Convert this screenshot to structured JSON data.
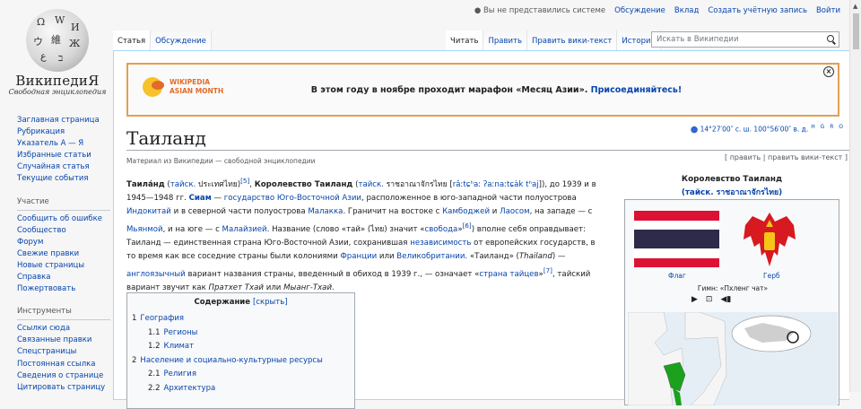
{
  "logo": {
    "title": "ВикипедиЯ",
    "subtitle": "Свободная энциклопедия"
  },
  "personal": {
    "anon": "Вы не представились системе",
    "links": [
      "Обсуждение",
      "Вклад",
      "Создать учётную запись",
      "Войти"
    ]
  },
  "tabs": {
    "left": [
      "Статья",
      "Обсуждение"
    ],
    "right": [
      "Читать",
      "Править",
      "Править вики-текст",
      "История"
    ]
  },
  "search": {
    "placeholder": "Искать в Википедии"
  },
  "sidebar": {
    "nav": [
      "Заглавная страница",
      "Рубрикация",
      "Указатель А — Я",
      "Избранные статьи",
      "Случайная статья",
      "Текущие события"
    ],
    "participation_head": "Участие",
    "participation": [
      "Сообщить об ошибке",
      "Сообщество",
      "Форум",
      "Свежие правки",
      "Новые страницы",
      "Справка",
      "Пожертвовать"
    ],
    "tools_head": "Инструменты",
    "tools": [
      "Ссылки сюда",
      "Связанные правки",
      "Спецстраницы",
      "Постоянная ссылка",
      "Сведения о странице",
      "Цитировать страницу"
    ]
  },
  "banner": {
    "brand": "WIKIPEDIA ASIAN MONTH",
    "message": "В этом году в ноябре проходит марафон «Месяц Азии».",
    "link": "Присоединяйтесь!"
  },
  "article": {
    "title": "Таиланд",
    "coords": "14°27′00″ с. ш. 100°56′00″ в. д.",
    "coords_links": "H G R O",
    "tagline": "Материал из Википедии — свободной энциклопедии",
    "edit_links": "[ править | править вики-текст ]"
  },
  "toc": {
    "title": "Содержание",
    "toggle": "[скрыть]",
    "items": [
      {
        "num": "1",
        "label": "География",
        "sub": false
      },
      {
        "num": "1.1",
        "label": "Регионы",
        "sub": true
      },
      {
        "num": "1.2",
        "label": "Климат",
        "sub": true
      },
      {
        "num": "2",
        "label": "Население и социально-культурные ресурсы",
        "sub": false
      },
      {
        "num": "2.1",
        "label": "Религия",
        "sub": true
      },
      {
        "num": "2.2",
        "label": "Архитектура",
        "sub": true
      }
    ]
  },
  "infobox": {
    "title": "Королевство Таиланд",
    "subtitle": "(тайск. ราชอาณาจักรไทย)",
    "flag_caption": "Флаг",
    "emblem_caption": "Герб",
    "anthem": "Гимн: «Пхленг чат»",
    "colors": {
      "flag_red": "#dd1133",
      "flag_blue": "#2d2a4a",
      "emblem_red": "#d71920"
    }
  }
}
